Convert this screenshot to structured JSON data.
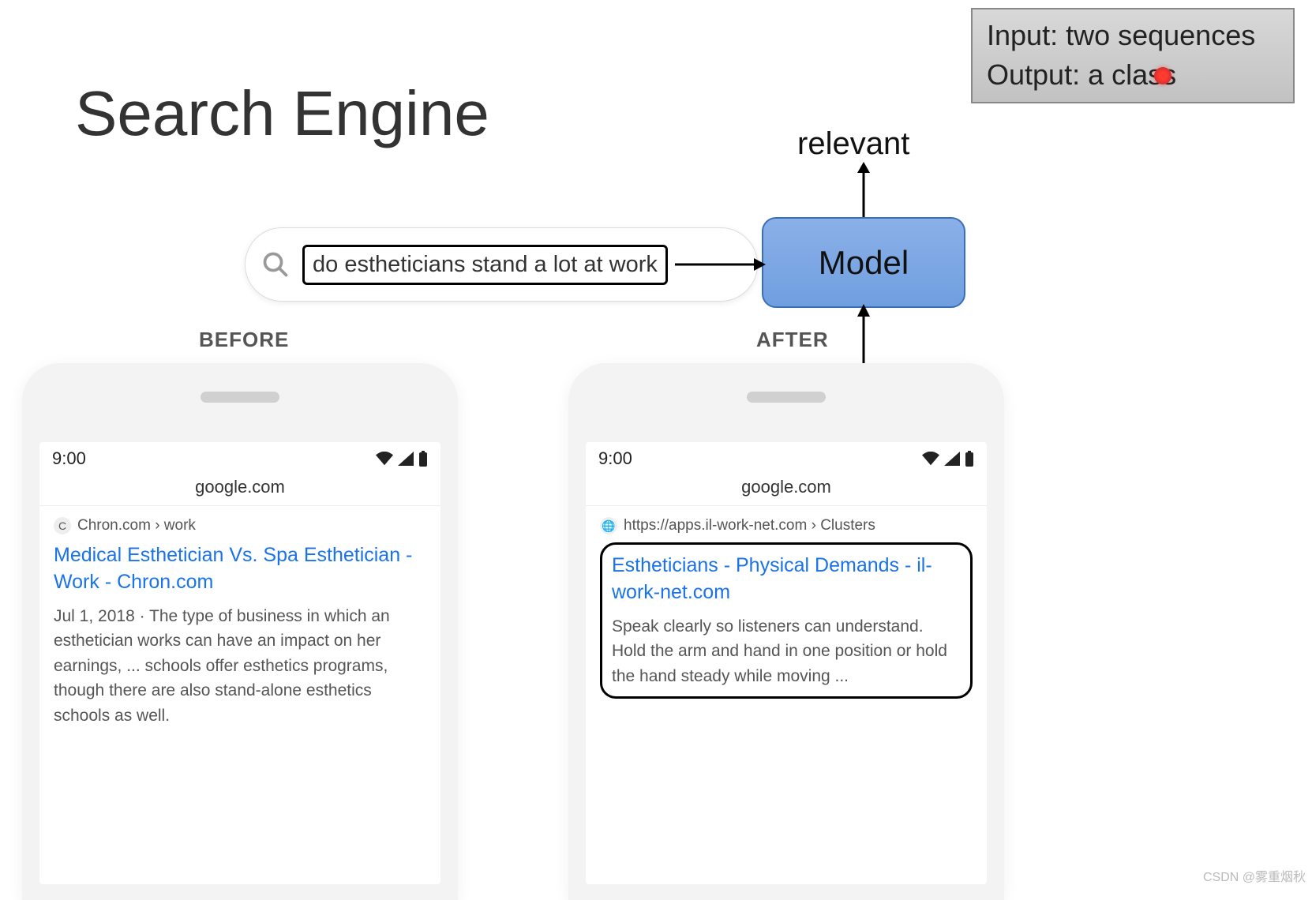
{
  "title": "Search Engine",
  "io_box": {
    "line1": "Input: two sequences",
    "line2": "Output: a class"
  },
  "relevant_label": "relevant",
  "model_label": "Model",
  "search_query": "do estheticians stand a lot at work",
  "labels": {
    "before": "BEFORE",
    "after": "AFTER"
  },
  "phone": {
    "time": "9:00",
    "url": "google.com"
  },
  "result_before": {
    "favicon_letter": "C",
    "breadcrumb": "Chron.com › work",
    "title": "Medical Esthetician Vs. Spa Esthetician - Work - Chron.com",
    "date": "Jul 1, 2018",
    "snippet": " · The type of business in which an esthetician works can have an impact on her earnings, ... schools offer esthetics programs, though there are also stand-alone esthetics schools as well."
  },
  "result_after": {
    "favicon_glyph": "🌐",
    "breadcrumb": "https://apps.il-work-net.com › Clusters",
    "title": "Estheticians - Physical Demands - il-work-net.com",
    "snippet": "Speak clearly so listeners can understand. Hold the arm and hand in one position or hold the hand steady while moving ..."
  },
  "watermark": "CSDN @雾重烟秋"
}
